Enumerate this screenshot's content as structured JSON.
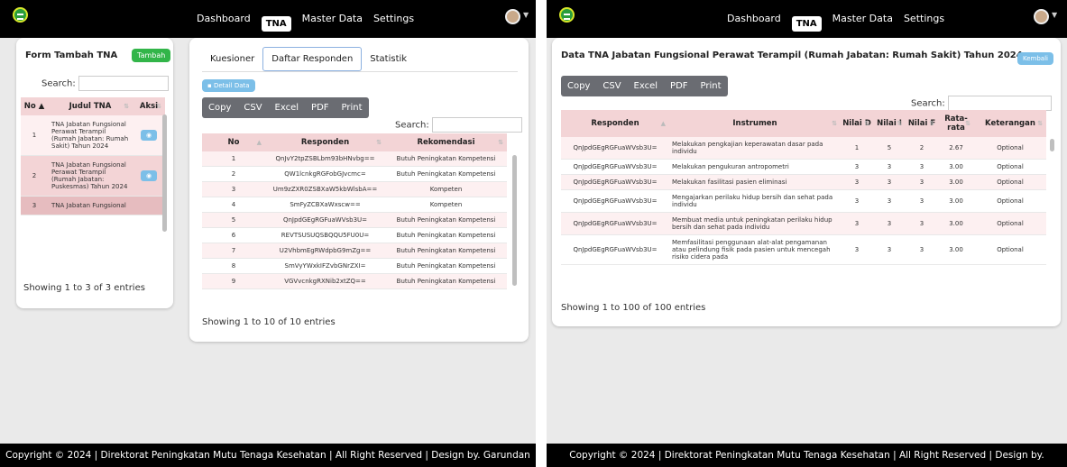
{
  "nav": {
    "dashboard": "Dashboard",
    "tna": "TNA",
    "master": "Master Data",
    "settings": "Settings"
  },
  "footer": "Copyright © 2024 | Direktorat Peningkatan Mutu Tenaga Kesehatan | All Right Reserved | Design by. Garundan",
  "left": {
    "form": {
      "title": "Form Tambah TNA",
      "add_label": "Tambah",
      "search_label": "Search:",
      "headers": [
        "No",
        "Judul TNA",
        "Aksi"
      ],
      "rows": [
        {
          "no": "1",
          "judul": "TNA Jabatan Fungsional Perawat Terampil (Rumah Jabatan: Rumah Sakit) Tahun 2024"
        },
        {
          "no": "2",
          "judul": "TNA Jabatan Fungsional Perawat Terampil (Rumah Jabatan: Puskesmas) Tahun 2024"
        },
        {
          "no": "3",
          "judul": "TNA Jabatan Fungsional"
        }
      ],
      "showing": "Showing 1 to 3 of 3 entries"
    },
    "resp": {
      "tabs": [
        "Kuesioner",
        "Daftar Responden",
        "Statistik"
      ],
      "detail": "Detail Data",
      "export": [
        "Copy",
        "CSV",
        "Excel",
        "PDF",
        "Print"
      ],
      "search_label": "Search:",
      "headers": [
        "No",
        "Responden",
        "Rekomendasi"
      ],
      "rows": [
        {
          "no": "1",
          "r": "QnJvY2tpZSBLbm93bHNvbg==",
          "k": "Butuh Peningkatan Kompetensi"
        },
        {
          "no": "2",
          "r": "QW1lcnkgRGFobGJvcmc=",
          "k": "Butuh Peningkatan Kompetensi"
        },
        {
          "no": "3",
          "r": "Um9zZXR0ZSBXaW5kbWlsbA==",
          "k": "Kompeten"
        },
        {
          "no": "4",
          "r": "SmFyZCBXaWxscw==",
          "k": "Kompeten"
        },
        {
          "no": "5",
          "r": "QnJpdGEgRGFuaWVsb3U=",
          "k": "Butuh Peningkatan Kompetensi"
        },
        {
          "no": "6",
          "r": "REVTSUSUQSBQQU5FU0U=",
          "k": "Butuh Peningkatan Kompetensi"
        },
        {
          "no": "7",
          "r": "U2VhbmEgRWdpbG9mZg==",
          "k": "Butuh Peningkatan Kompetensi"
        },
        {
          "no": "8",
          "r": "SmVyYWxkIFZvbGNrZXI=",
          "k": "Butuh Peningkatan Kompetensi"
        },
        {
          "no": "9",
          "r": "VGVvcnkgRXNib2xtZQ==",
          "k": "Butuh Peningkatan Kompetensi"
        }
      ],
      "showing": "Showing 1 to 10 of 10 entries"
    }
  },
  "right": {
    "title": "Data TNA Jabatan Fungsional Perawat Terampil (Rumah Jabatan: Rumah Sakit) Tahun 2024",
    "back": "Kembali",
    "export": [
      "Copy",
      "CSV",
      "Excel",
      "PDF",
      "Print"
    ],
    "search_label": "Search:",
    "headers": [
      "Responden",
      "Instrumen",
      "Nilai D",
      "Nilai I",
      "Nilai F",
      "Rata-rata",
      "Keterangan"
    ],
    "rows": [
      {
        "r": "QnJpdGEgRGFuaWVsb3U=",
        "i": "Melakukan pengkajian keperawatan dasar pada individu",
        "d": "1",
        "n": "5",
        "f": "2",
        "avg": "2.67",
        "k": "Optional"
      },
      {
        "r": "QnJpdGEgRGFuaWVsb3U=",
        "i": "Melakukan pengukuran antropometri",
        "d": "3",
        "n": "3",
        "f": "3",
        "avg": "3.00",
        "k": "Optional"
      },
      {
        "r": "QnJpdGEgRGFuaWVsb3U=",
        "i": "Melakukan fasilitasi pasien eliminasi",
        "d": "3",
        "n": "3",
        "f": "3",
        "avg": "3.00",
        "k": "Optional"
      },
      {
        "r": "QnJpdGEgRGFuaWVsb3U=",
        "i": "Mengajarkan perilaku hidup bersih dan sehat pada individu",
        "d": "3",
        "n": "3",
        "f": "3",
        "avg": "3.00",
        "k": "Optional"
      },
      {
        "r": "QnJpdGEgRGFuaWVsb3U=",
        "i": "Membuat media untuk peningkatan perilaku hidup bersih dan sehat pada individu",
        "d": "3",
        "n": "3",
        "f": "3",
        "avg": "3.00",
        "k": "Optional"
      },
      {
        "r": "QnJpdGEgRGFuaWVsb3U=",
        "i": "Memfasilitasi penggunaan alat-alat pengamanan atau pelindung fisik pada pasien untuk mencegah risiko cidera pada",
        "d": "3",
        "n": "3",
        "f": "3",
        "avg": "3.00",
        "k": "Optional"
      }
    ],
    "showing": "Showing 1 to 100 of 100 entries"
  }
}
